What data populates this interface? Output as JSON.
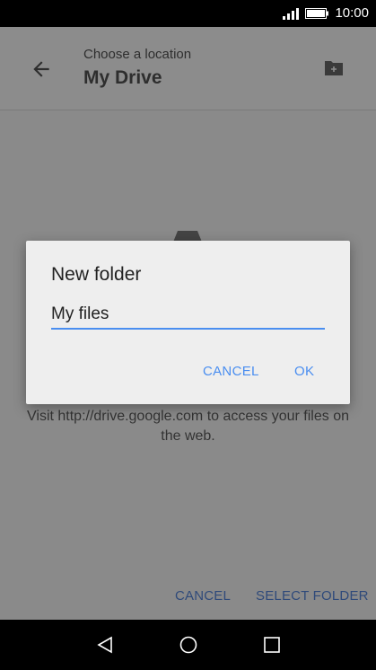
{
  "status_bar": {
    "time": "10:00"
  },
  "app_bar": {
    "subtitle": "Choose a location",
    "title": "My Drive"
  },
  "content": {
    "empty_message": "Visit http://drive.google.com to access your files on the web."
  },
  "footer": {
    "cancel_label": "CANCEL",
    "select_label": "SELECT FOLDER"
  },
  "dialog": {
    "title": "New folder",
    "input_value": "My files",
    "cancel_label": "CANCEL",
    "ok_label": "OK"
  },
  "colors": {
    "accent": "#4a8ef0",
    "scrim": "#8a8a8a",
    "dialog_bg": "#eeeeee"
  },
  "icons": [
    "signal-icon",
    "battery-icon",
    "back-arrow-icon",
    "new-folder-icon",
    "drive-icon",
    "nav-back-icon",
    "nav-home-icon",
    "nav-recents-icon"
  ]
}
